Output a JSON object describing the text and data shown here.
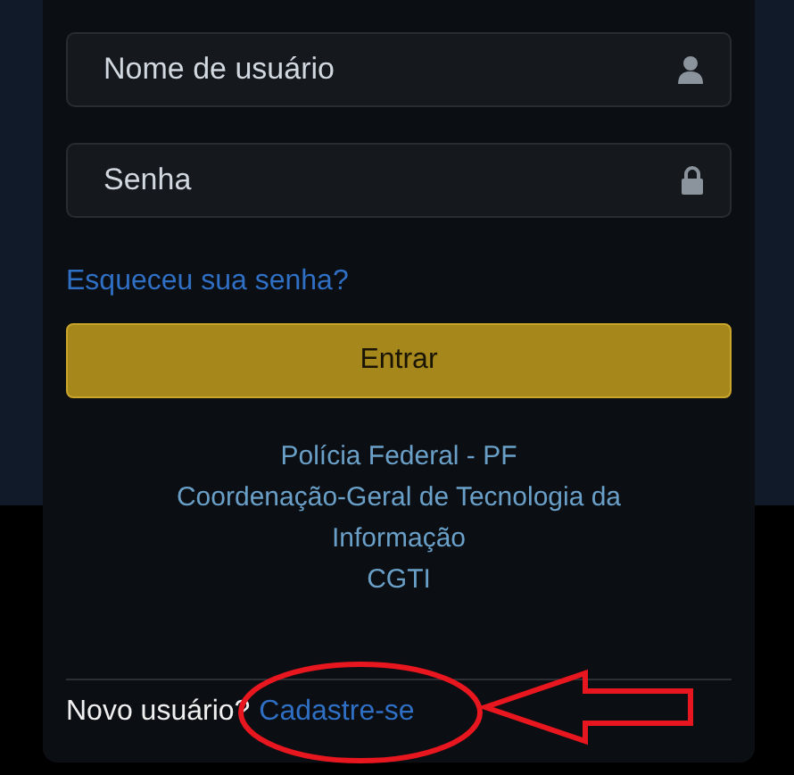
{
  "fields": [
    {
      "kind": "user",
      "placeholder": "Nome de usuário"
    },
    {
      "kind": "password",
      "placeholder": "Senha"
    }
  ],
  "forgot_link": "Esqueceu sua senha?",
  "submit_button": "Entrar",
  "footer_lines": [
    "Polícia Federal - PF",
    "Coordenação-Geral de Tecnologia da Informação",
    "CGTI"
  ],
  "register": {
    "prompt": "Novo usuário?",
    "link": "Cadastre-se"
  }
}
